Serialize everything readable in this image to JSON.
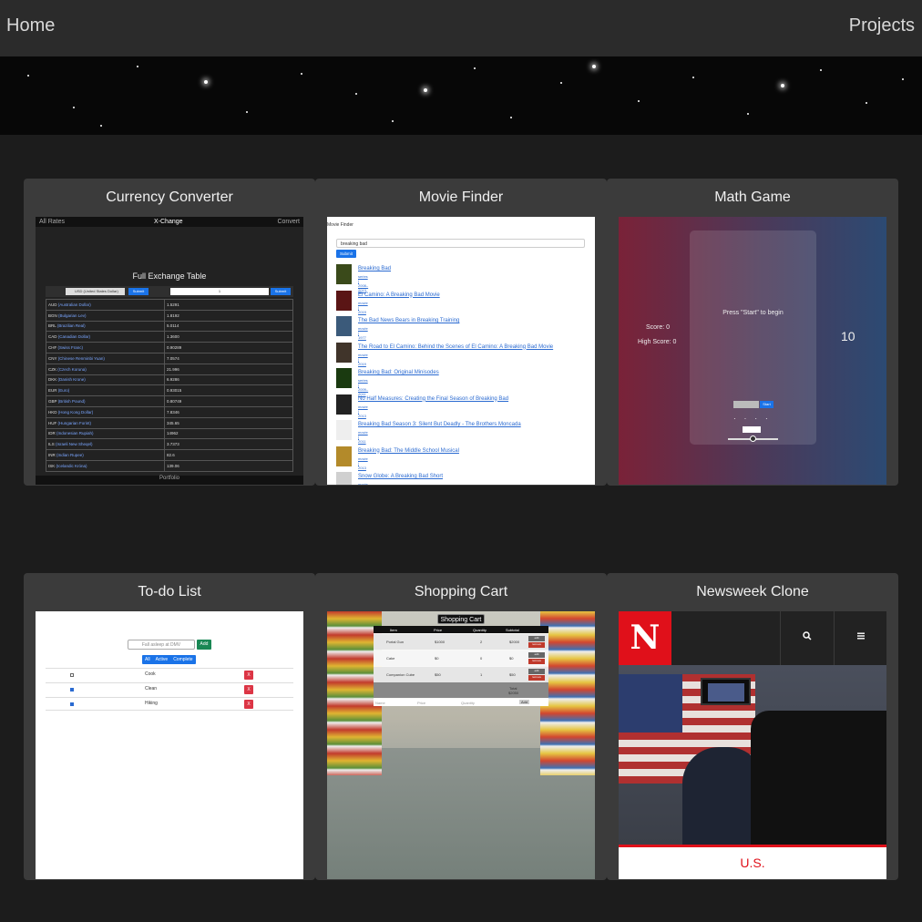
{
  "nav": {
    "home": "Home",
    "projects": "Projects"
  },
  "projects": [
    {
      "title": "Currency Converter"
    },
    {
      "title": "Movie Finder"
    },
    {
      "title": "Math Game"
    },
    {
      "title": "To-do List"
    },
    {
      "title": "Shopping Cart"
    },
    {
      "title": "Newsweek Clone"
    }
  ],
  "currency": {
    "left": "All Rates",
    "brand": "X-Change",
    "right": "Convert",
    "table_title": "Full Exchange Table",
    "base": "USD (United States Dollar)",
    "amount": "1",
    "submit": "Submit",
    "rows": [
      [
        "AUD",
        "(Australian Dollar)",
        "1.5291"
      ],
      [
        "BGN",
        "(Bulgarian Lev)",
        "1.8192"
      ],
      [
        "BRL",
        "(Brazilian Real)",
        "5.0114"
      ],
      [
        "CAD",
        "(Canadian Dollar)",
        "1.3600"
      ],
      [
        "CHF",
        "(Swiss Franc)",
        "0.90289"
      ],
      [
        "CNY",
        "(Chinese Renminbi Yuan)",
        "7.0574"
      ],
      [
        "CZK",
        "(Czech Koruna)",
        "21.996"
      ],
      [
        "DKK",
        "(Danish Krone)",
        "6.9286"
      ],
      [
        "EUR",
        "(Euro)",
        "0.93015"
      ],
      [
        "GBP",
        "(British Pound)",
        "0.80749"
      ],
      [
        "HKD",
        "(Hong Kong Dollar)",
        "7.8346"
      ],
      [
        "HUF",
        "(Hungarian Forint)",
        "345.65"
      ],
      [
        "IDR",
        "(Indonesian Rupiah)",
        "14962"
      ],
      [
        "ILS",
        "(Israeli New Sheqel)",
        "3.7373"
      ],
      [
        "INR",
        "(Indian Rupee)",
        "82.6"
      ],
      [
        "ISK",
        "(Icelandic Króna)",
        "139.06"
      ]
    ],
    "footer": "Portfolio"
  },
  "movie": {
    "header": "Movie Finder",
    "query": "breaking bad",
    "submit": "Submit",
    "results": [
      {
        "title": "Breaking Bad",
        "meta": "series | 2008–2013"
      },
      {
        "title": "El Camino: A Breaking Bad Movie",
        "meta": "movie | 2019"
      },
      {
        "title": "The Bad News Bears in Breaking Training",
        "meta": "movie | 1977"
      },
      {
        "title": "The Road to El Camino: Behind the Scenes of El Camino: A Breaking Bad Movie",
        "meta": "movie | 2019"
      },
      {
        "title": "Breaking Bad: Original Minisodes",
        "meta": "series | 2009–2011"
      },
      {
        "title": "No Half Measures: Creating the Final Season of Breaking Bad",
        "meta": "movie | 2013"
      },
      {
        "title": "Breaking Bad Season 3: Silent But Deadly - The Brothers Moncada",
        "meta": "movie | 2011"
      },
      {
        "title": "Breaking Bad: The Middle School Musical",
        "meta": "movie | 2013"
      },
      {
        "title": "Snow Globe: A Breaking Bad Short",
        "meta": "movie | 2020"
      }
    ]
  },
  "math": {
    "prompt": "Press \"Start\" to begin",
    "score": "Score: 0",
    "high": "High Score: 0",
    "timer": "10",
    "start": "Start"
  },
  "todo": {
    "placeholder": "Fall asleep at DMV",
    "add": "Add",
    "filters": [
      "All",
      "Active",
      "Complete"
    ],
    "items": [
      {
        "label": "Cook",
        "done": false
      },
      {
        "label": "Clean",
        "done": true
      },
      {
        "label": "Hiking",
        "done": true
      }
    ],
    "delete": "X"
  },
  "shop": {
    "title": "Shopping Cart",
    "headers": [
      "Item",
      "Price",
      "Quantity",
      "Subtotal"
    ],
    "rows": [
      [
        "Portal Gun",
        "$1000",
        "2",
        "$2000"
      ],
      [
        "Cake",
        "$0",
        "0",
        "$0"
      ],
      [
        "Companion Cube",
        "$50",
        "1",
        "$50"
      ]
    ],
    "total_label": "Total",
    "total": "$2050",
    "edit": "edit",
    "remove": "remove",
    "name_ph": "Name",
    "price_ph": "Price",
    "qty_ph": "Quantity",
    "add": "Add"
  },
  "news": {
    "section": "U.S."
  }
}
